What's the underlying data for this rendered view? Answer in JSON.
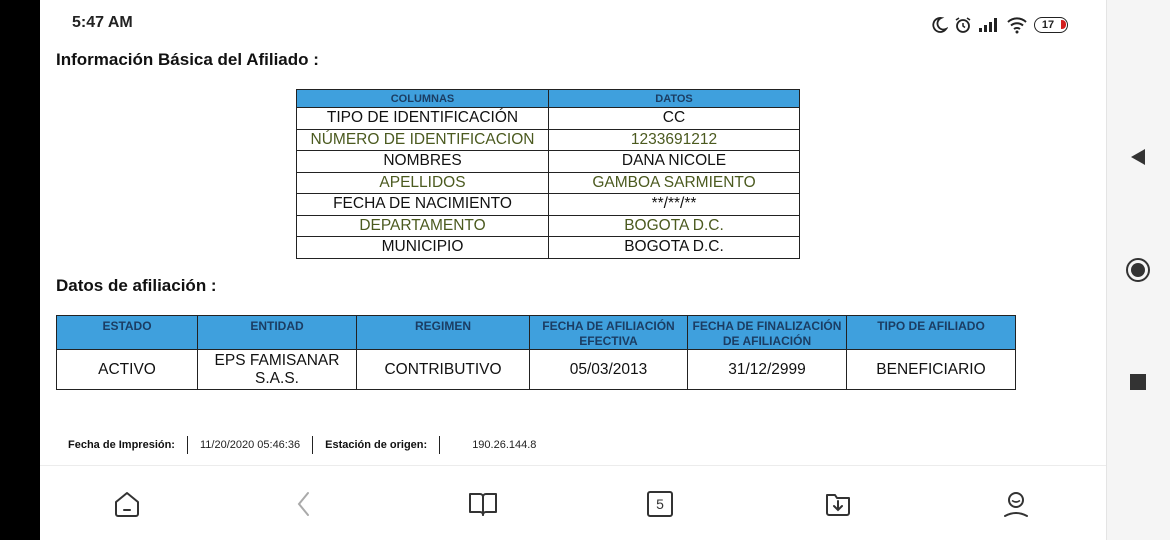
{
  "status_bar": {
    "time": "5:47 AM",
    "battery": "17",
    "icons": [
      "moon-icon",
      "alarm-icon",
      "signal-icon",
      "wifi-icon",
      "battery-icon"
    ]
  },
  "basic_info": {
    "title": "Información Básica del Afiliado :",
    "headers": [
      "COLUMNAS",
      "DATOS"
    ],
    "rows": [
      [
        "TIPO DE IDENTIFICACIÓN",
        "CC"
      ],
      [
        "NÚMERO DE IDENTIFICACION",
        "1233691212"
      ],
      [
        "NOMBRES",
        "DANA NICOLE"
      ],
      [
        "APELLIDOS",
        "GAMBOA SARMIENTO"
      ],
      [
        "FECHA DE NACIMIENTO",
        "**/**/**"
      ],
      [
        "DEPARTAMENTO",
        "BOGOTA D.C."
      ],
      [
        "MUNICIPIO",
        "BOGOTA D.C."
      ]
    ]
  },
  "afiliacion": {
    "title": "Datos de afiliación :",
    "headers": [
      "ESTADO",
      "ENTIDAD",
      "REGIMEN",
      "FECHA DE AFILIACIÓN EFECTIVA",
      "FECHA DE FINALIZACIÓN DE AFILIACIÓN",
      "TIPO DE AFILIADO"
    ],
    "row": [
      "ACTIVO",
      "EPS FAMISANAR S.A.S.",
      "CONTRIBUTIVO",
      "05/03/2013",
      "31/12/2999",
      "BENEFICIARIO"
    ]
  },
  "print_info": {
    "fecha_label": "Fecha de Impresión:",
    "fecha_value": "11/20/2020 05:46:36",
    "estacion_label": "Estación de origen:",
    "estacion_value": "190.26.144.8"
  },
  "bottom_nav": {
    "tabs_count": "5",
    "icons": [
      "home-icon",
      "back-icon",
      "bookmarks-icon",
      "tabs-icon",
      "downloads-icon",
      "profile-icon"
    ]
  },
  "system_nav": {
    "icons": [
      "system-back-icon",
      "system-home-icon",
      "system-recents-icon"
    ]
  },
  "colors": {
    "header_blue": "#3fa0dd",
    "header_text": "#1b3d63",
    "alt_row_text": "#4b5a1f",
    "battery_low": "#d32020"
  }
}
